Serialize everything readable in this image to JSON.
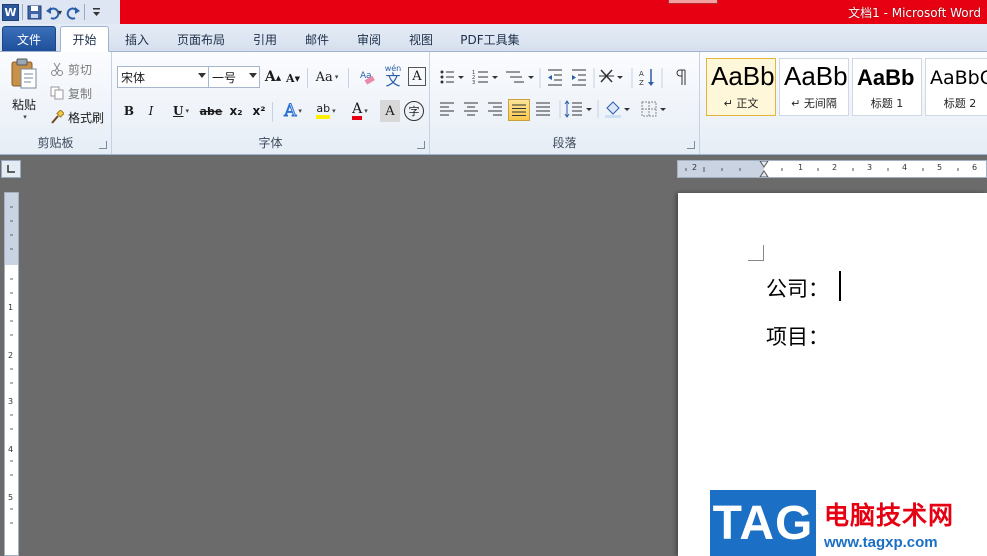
{
  "titlebar": {
    "title": "文档1 - Microsoft Word",
    "app_logo_letter": "W"
  },
  "tabs": [
    {
      "label": "文件"
    },
    {
      "label": "开始"
    },
    {
      "label": "插入"
    },
    {
      "label": "页面布局"
    },
    {
      "label": "引用"
    },
    {
      "label": "邮件"
    },
    {
      "label": "审阅"
    },
    {
      "label": "视图"
    },
    {
      "label": "PDF工具集"
    }
  ],
  "clipboard": {
    "paste": "粘贴",
    "cut": "剪切",
    "copy": "复制",
    "format_painter": "格式刷",
    "group_label": "剪贴板"
  },
  "font": {
    "font_name": "宋体",
    "font_size": "一号",
    "grow": "A",
    "shrink": "A",
    "change_case": "Aa",
    "wen": "wén",
    "wen_char": "文",
    "bold": "B",
    "italic": "I",
    "underline": "U",
    "strikethrough": "abe",
    "subscript": "x₂",
    "superscript": "x²",
    "text_effect": "A",
    "highlight": "ab",
    "font_color": "A",
    "char_shading": "A",
    "enclose": "字",
    "group_label": "字体"
  },
  "paragraph": {
    "group_label": "段落"
  },
  "styles": [
    {
      "sample": "AaBbCcDd",
      "name": "↵ 正文"
    },
    {
      "sample": "AaBbCcDd",
      "name": "↵ 无间隔"
    },
    {
      "sample": "AaBb",
      "name": "标题 1"
    },
    {
      "sample": "AaBbC",
      "name": "标题 2"
    }
  ],
  "ruler": {
    "h_labels": [
      "2",
      "2",
      "1",
      "2",
      "3",
      "4",
      "5",
      "6"
    ],
    "v_labels": [
      "1",
      "2",
      "3",
      "4",
      "5"
    ]
  },
  "document": {
    "line1": "公司：",
    "line2": "项目："
  },
  "watermark": {
    "logo": "TAG",
    "name": "电脑技术网",
    "url": "www.tagxp.com"
  },
  "colors": {
    "titlebar": "#e60012",
    "file_tab": "#2b5ea8",
    "accent_blue": "#1b6fc4"
  }
}
